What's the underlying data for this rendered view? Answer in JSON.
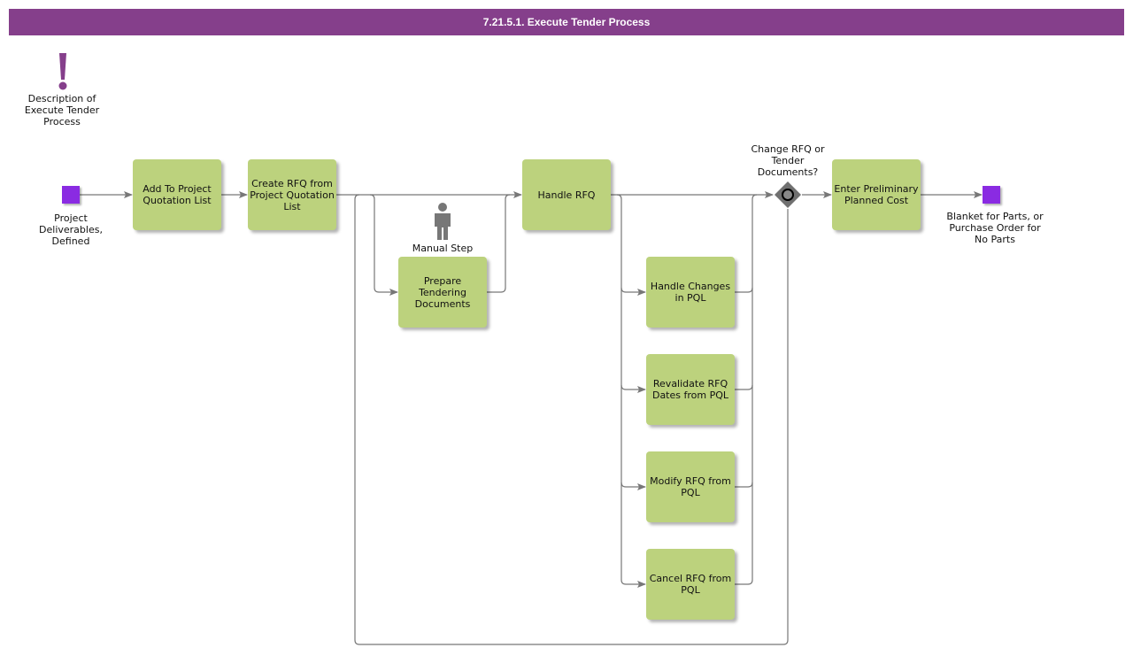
{
  "title": "7.21.5.1. Execute Tender Process",
  "description": {
    "icon": "exclamation-icon",
    "label": "Description of Execute Tender Process"
  },
  "colors": {
    "title_bar": "#853f8b",
    "task_fill": "#bcd27d",
    "event_fill": "#8a2be2",
    "connector": "#777777",
    "gateway": "#707070"
  },
  "events": {
    "start": {
      "label": "Project Deliverables, Defined"
    },
    "end": {
      "label": "Blanket for Parts, or Purchase Order for No Parts"
    }
  },
  "tasks": {
    "add_to_pql": "Add To Project Quotation List",
    "create_rfq": "Create RFQ from Project Quotation List",
    "prepare_docs": "Prepare Tendering Documents",
    "handle_rfq": "Handle RFQ",
    "handle_changes": "Handle Changes in PQL",
    "revalidate": "Revalidate RFQ Dates from PQL",
    "modify_rfq": "Modify RFQ from PQL",
    "cancel_rfq": "Cancel RFQ from PQL",
    "enter_cost": "Enter Preliminary Planned Cost"
  },
  "manual_step": {
    "icon": "person-icon",
    "label": "Manual Step"
  },
  "gateway": {
    "icon": "gateway-icon",
    "label": "Change RFQ or Tender Documents?"
  }
}
